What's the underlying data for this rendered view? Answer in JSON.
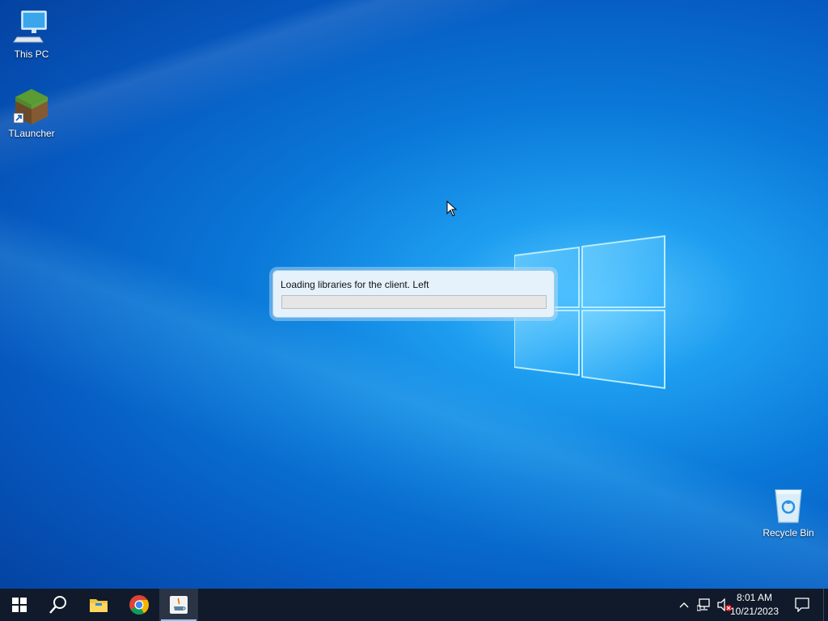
{
  "desktop": {
    "icons": [
      {
        "label": "This PC",
        "icon": "this-pc-icon"
      },
      {
        "label": "TLauncher",
        "icon": "tlauncher-icon"
      },
      {
        "label": "Recycle Bin",
        "icon": "recycle-bin-icon"
      }
    ]
  },
  "dialog": {
    "message": "Loading libraries for the client. Left",
    "progress": 0
  },
  "taskbar": {
    "buttons": [
      {
        "name": "start",
        "icon": "windows-start-icon"
      },
      {
        "name": "search",
        "icon": "search-icon"
      },
      {
        "name": "file-explorer",
        "icon": "folder-icon"
      },
      {
        "name": "chrome",
        "icon": "chrome-icon"
      },
      {
        "name": "java",
        "icon": "java-icon"
      }
    ],
    "tray": {
      "icons": [
        "chevron-up-icon",
        "network-icon",
        "volume-muted-icon"
      ],
      "time": "8:01 AM",
      "date": "10/21/2023"
    }
  },
  "colors": {
    "accent": "#0a78d8",
    "taskbar": "#101a2a",
    "progress_fill": "#06b025"
  }
}
